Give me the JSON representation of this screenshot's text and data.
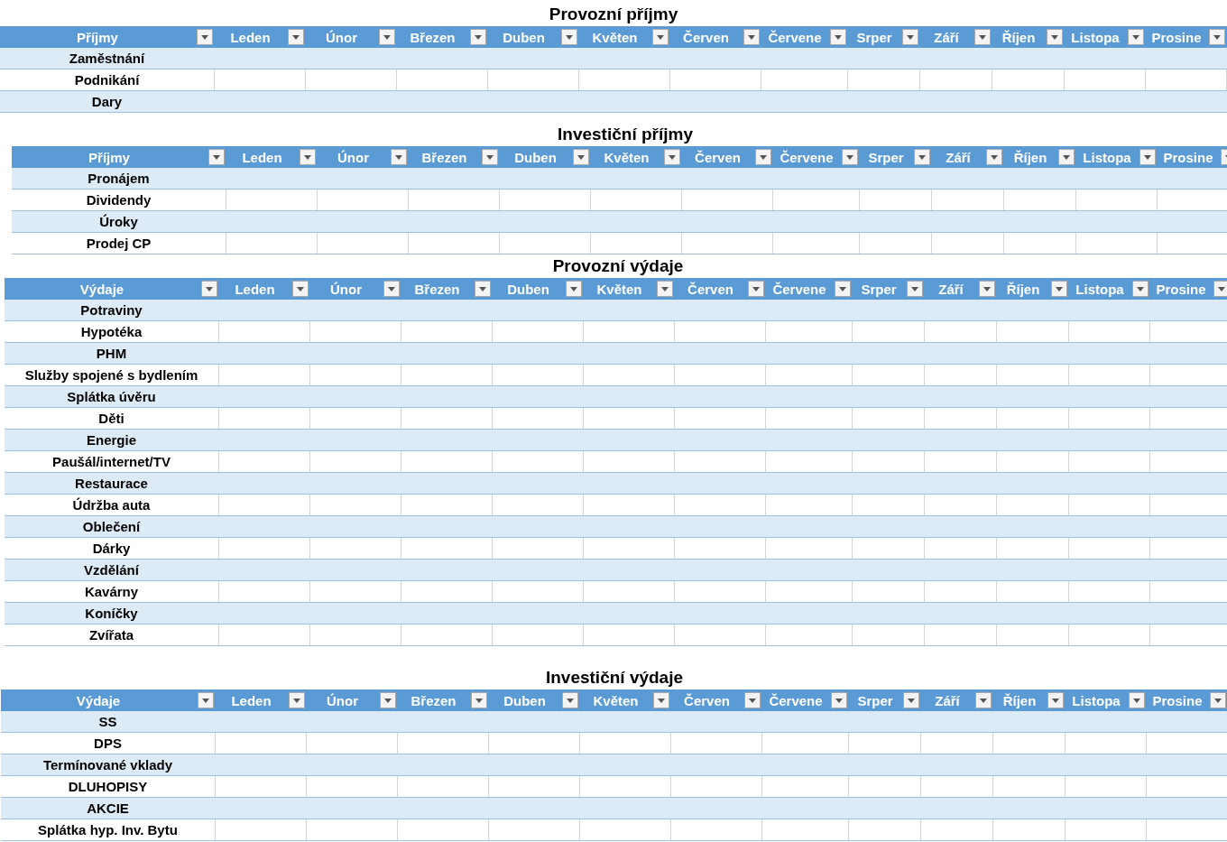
{
  "tables": [
    {
      "title": "Provozní příjmy",
      "columns": [
        "Příjmy",
        "Leden",
        "Únor",
        "Březen",
        "Duben",
        "Květen",
        "Červen",
        "Červene",
        "Srper",
        "Září",
        "Říjen",
        "Listopa",
        "Prosine"
      ],
      "rows": [
        {
          "label": "Zaměstnání"
        },
        {
          "label": "Podnikání"
        },
        {
          "label": "Dary"
        }
      ]
    },
    {
      "title": "Investiční příjmy",
      "columns": [
        "Příjmy",
        "Leden",
        "Únor",
        "Březen",
        "Duben",
        "Květen",
        "Červen",
        "Červene",
        "Srper",
        "Září",
        "Říjen",
        "Listopa",
        "Prosine"
      ],
      "rows": [
        {
          "label": "Pronájem"
        },
        {
          "label": "Dividendy"
        },
        {
          "label": "Úroky"
        },
        {
          "label": "Prodej CP"
        }
      ]
    },
    {
      "title": "Provozní výdaje",
      "columns": [
        "Výdaje",
        "Leden",
        "Únor",
        "Březen",
        "Duben",
        "Květen",
        "Červen",
        "Červene",
        "Srper",
        "Září",
        "Říjen",
        "Listopa",
        "Prosine"
      ],
      "rows": [
        {
          "label": "Potraviny"
        },
        {
          "label": "Hypotéka"
        },
        {
          "label": "PHM"
        },
        {
          "label": "Služby spojené s bydlením"
        },
        {
          "label": "Splátka úvěru"
        },
        {
          "label": "Děti"
        },
        {
          "label": "Energie"
        },
        {
          "label": "Paušál/internet/TV"
        },
        {
          "label": "Restaurace"
        },
        {
          "label": "Údržba auta"
        },
        {
          "label": "Oblečení"
        },
        {
          "label": "Dárky"
        },
        {
          "label": "Vzdělání"
        },
        {
          "label": "Kavárny"
        },
        {
          "label": "Koníčky"
        },
        {
          "label": "Zvířata"
        }
      ]
    },
    {
      "title": "Investiční výdaje",
      "columns": [
        "Výdaje",
        "Leden",
        "Únor",
        "Březen",
        "Duben",
        "Květen",
        "Červen",
        "Červene",
        "Srper",
        "Září",
        "Říjen",
        "Listopa",
        "Prosine"
      ],
      "rows": [
        {
          "label": "SS"
        },
        {
          "label": "DPS"
        },
        {
          "label": "Termínované vklady"
        },
        {
          "label": "DLUHOPISY"
        },
        {
          "label": "AKCIE"
        },
        {
          "label": "Splátka hyp. Inv. Bytu"
        }
      ]
    }
  ]
}
